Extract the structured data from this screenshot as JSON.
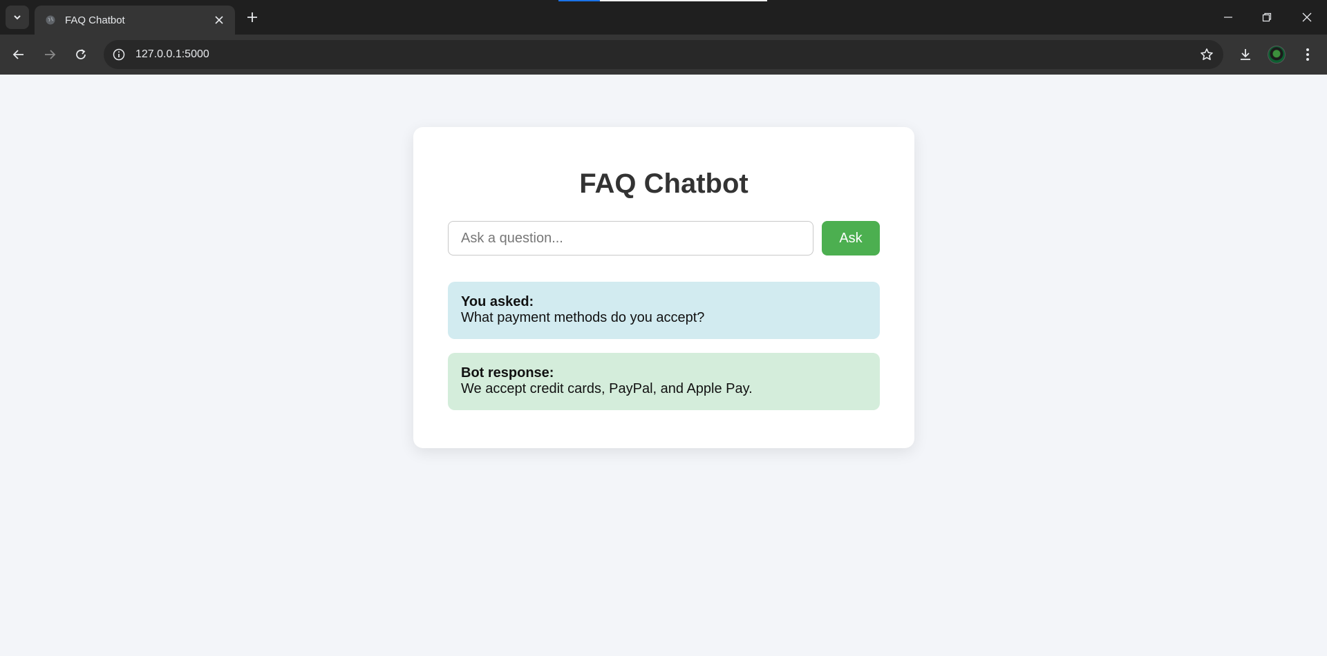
{
  "browser": {
    "tab_title": "FAQ Chatbot",
    "url": "127.0.0.1:5000"
  },
  "page": {
    "title": "FAQ Chatbot",
    "input_placeholder": "Ask a question...",
    "input_value": "",
    "ask_label": "Ask"
  },
  "conversation": {
    "user_label": "You asked:",
    "user_text": "What payment methods do you accept?",
    "bot_label": "Bot response:",
    "bot_text": "We accept credit cards, PayPal, and Apple Pay."
  },
  "colors": {
    "ask_button": "#4caf50",
    "user_bubble": "#d2ebf0",
    "bot_bubble": "#d4eddb",
    "page_background": "#f3f5f9"
  }
}
